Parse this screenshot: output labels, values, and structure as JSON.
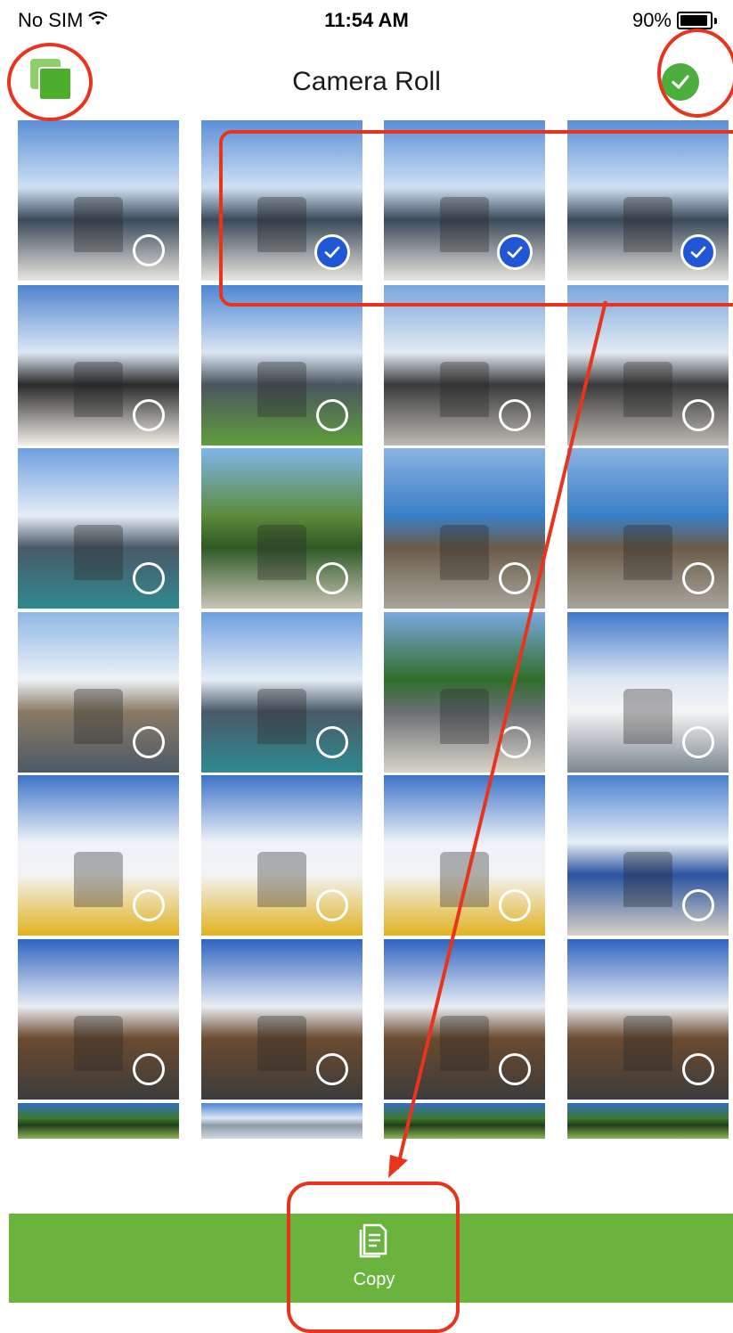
{
  "status_bar": {
    "carrier": "No SIM",
    "wifi_icon": "wifi-icon",
    "time": "11:54 AM",
    "battery_percent": "90%",
    "battery_level": 0.9
  },
  "nav": {
    "title": "Camera Roll",
    "left_icon": "multi-select-icon",
    "right_icon": "checkmark-circle-icon"
  },
  "grid": {
    "columns": 4,
    "tiles": [
      {
        "scene": "Sailor kissing nurse statue with ship",
        "selected": false
      },
      {
        "scene": "Sailor kissing nurse statue with ship",
        "selected": true
      },
      {
        "scene": "Sailor kissing nurse statue with ship",
        "selected": true
      },
      {
        "scene": "Sailor kissing nurse statue with ship",
        "selected": true
      },
      {
        "scene": "Statue close-up with sky",
        "selected": false
      },
      {
        "scene": "Aircraft carrier on lawn",
        "selected": false
      },
      {
        "scene": "Bronze bust memorial",
        "selected": false
      },
      {
        "scene": "Bronze bust memorial",
        "selected": false
      },
      {
        "scene": "Aircraft carrier across water",
        "selected": false
      },
      {
        "scene": "Trees and walkway",
        "selected": false
      },
      {
        "scene": "Street musician with guitar",
        "selected": false
      },
      {
        "scene": "Street musician with guitar",
        "selected": false
      },
      {
        "scene": "Aircraft on carrier deck",
        "selected": false
      },
      {
        "scene": "Aircraft carrier across water",
        "selected": false
      },
      {
        "scene": "Tree near carrier",
        "selected": false
      },
      {
        "scene": "Cruise ship",
        "selected": false
      },
      {
        "scene": "Cruise ship at pier",
        "selected": false
      },
      {
        "scene": "Cruise ship at pier",
        "selected": false
      },
      {
        "scene": "Cruise ship at pier",
        "selected": false
      },
      {
        "scene": "Cruise terminal",
        "selected": false
      },
      {
        "scene": "Tall sailing ship",
        "selected": false
      },
      {
        "scene": "Tall sailing ship",
        "selected": false
      },
      {
        "scene": "Tall sailing ship",
        "selected": false
      },
      {
        "scene": "Tall sailing ship",
        "selected": false
      },
      {
        "scene": "Palm trees",
        "selected": false
      },
      {
        "scene": "Street lamp",
        "selected": false
      },
      {
        "scene": "Palm trees",
        "selected": false
      },
      {
        "scene": "Palm trees",
        "selected": false
      }
    ]
  },
  "bottom_bar": {
    "copy_label": "Copy",
    "copy_icon": "copy-document-icon"
  },
  "colors": {
    "accent_green": "#6ab43e",
    "select_blue": "#1f57d6",
    "annotation_red": "#e8341c"
  }
}
